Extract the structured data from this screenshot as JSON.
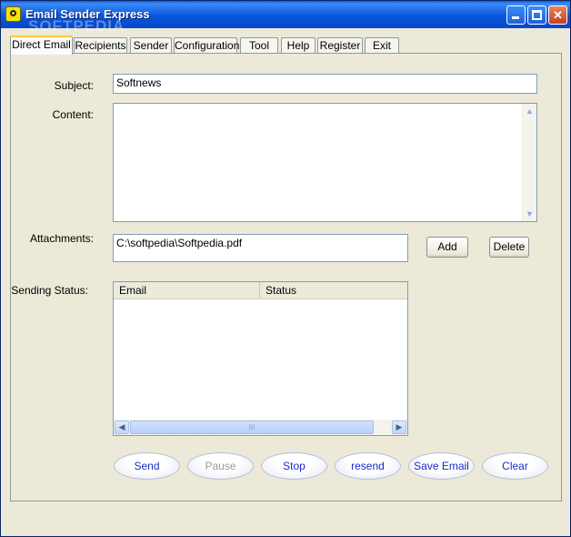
{
  "window": {
    "title": "Email Sender Express",
    "watermark": "SOFTPEDIA",
    "minimize_icon": "minimize-icon",
    "maximize_icon": "maximize-icon",
    "close_label": "✕"
  },
  "tabs": [
    {
      "label": "Direct Email",
      "active": true
    },
    {
      "label": "Recipients"
    },
    {
      "label": "Sender"
    },
    {
      "label": "Configuration"
    },
    {
      "label": "Tool"
    },
    {
      "label": "Help"
    },
    {
      "label": "Register"
    },
    {
      "label": "Exit"
    }
  ],
  "form": {
    "subject_label": "Subject:",
    "subject_value": "Softnews",
    "content_label": "Content:",
    "content_value": "",
    "attachments_label": "Attachments:",
    "attachments_value": "C:\\softpedia\\Softpedia.pdf",
    "add_label": "Add",
    "delete_label": "Delete",
    "sending_status_label": "Sending Status:"
  },
  "status_table": {
    "columns": [
      "Email",
      "Status"
    ],
    "rows": [],
    "scroll_thumb_glyph": "III"
  },
  "actions": [
    {
      "label": "Send",
      "enabled": true
    },
    {
      "label": "Pause",
      "enabled": false
    },
    {
      "label": "Stop",
      "enabled": true
    },
    {
      "label": "resend",
      "enabled": true
    },
    {
      "label": "Save Email",
      "enabled": true
    },
    {
      "label": "Clear",
      "enabled": true
    }
  ],
  "colors": {
    "title_bar": "#0a5fd8",
    "active_tab_accent": "#ffc83c",
    "action_text": "#1a2bc8",
    "disabled_text": "#9a9a9a"
  }
}
